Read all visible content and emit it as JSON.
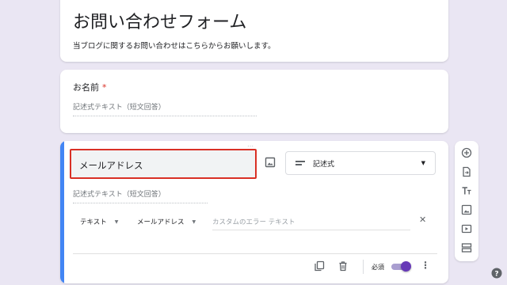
{
  "form": {
    "title": "お問い合わせフォーム",
    "description": "当ブログに関するお問い合わせはこちらからお願いします。"
  },
  "questions": [
    {
      "label": "お名前",
      "required_mark": "*",
      "answer_placeholder": "記述式テキスト（短文回答）"
    },
    {
      "label": "メールアドレス",
      "answer_placeholder": "記述式テキスト（短文回答）",
      "type": "記述式",
      "validation": {
        "kind": "テキスト",
        "option": "メールアドレス",
        "error_placeholder": "カスタムのエラー テキスト"
      },
      "required_label": "必須",
      "required": true
    }
  ],
  "colors": {
    "accent": "#4285f4",
    "toggle": "#673ab7",
    "error_border": "#d93025",
    "background": "#eae6f3"
  },
  "icons": {
    "drag": "⋯",
    "clear": "✕",
    "more": "⋮",
    "caret": "▼"
  },
  "toolbar": [
    "add-question-icon",
    "import-questions-icon",
    "add-title-icon",
    "add-image-icon",
    "add-video-icon",
    "add-section-icon"
  ]
}
